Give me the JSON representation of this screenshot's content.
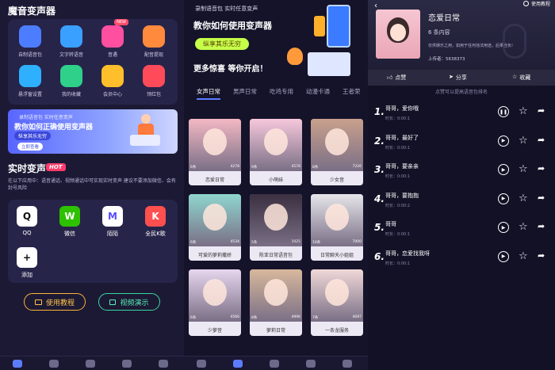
{
  "left": {
    "title": "魔音变声器",
    "tools": [
      {
        "label": "自制语音包",
        "color": "#4c7dff"
      },
      {
        "label": "文字转语音",
        "color": "#3aa0ff"
      },
      {
        "label": "音遇",
        "color": "#ff4fa0",
        "badge": "NEW"
      },
      {
        "label": "配音提现",
        "color": "#ff8a3d"
      },
      {
        "label": "悬浮窗设置",
        "color": "#2fb0ff"
      },
      {
        "label": "我的收藏",
        "color": "#2fd08a"
      },
      {
        "label": "会员中心",
        "color": "#ffbf2a"
      },
      {
        "label": "领红包",
        "color": "#ff4a5a"
      }
    ],
    "banner": {
      "line1": "录制语音包  实时任意变声",
      "line2": "教你如何正确使用变声器",
      "line3": "纵享其乐无穷",
      "button": "立即查看"
    },
    "section": "实时变声",
    "hot": "HOT",
    "desc": "在以下应用中：语音通话、视频通话中可实现实时变声 建议不要添加微信、会有封号风险",
    "apps": [
      {
        "label": "QQ",
        "glyph": "Q",
        "color": "#ffffff",
        "fg": "#111111"
      },
      {
        "label": "微信",
        "glyph": "W",
        "color": "#2dc100",
        "fg": "#ffffff"
      },
      {
        "label": "陌陌",
        "glyph": "M",
        "color": "#ffffff",
        "fg": "#5a4bff"
      },
      {
        "label": "全民K歌",
        "glyph": "K",
        "color": "#ff4f4f",
        "fg": "#ffffff"
      },
      {
        "label": "添加",
        "glyph": "+",
        "color": "#ffffff",
        "fg": "#111111"
      }
    ],
    "btn_tutorial": "使用教程",
    "btn_video": "视频演示"
  },
  "middle": {
    "top_line": "录制语音包   实时任意变声",
    "headline": "教你如何使用变声器",
    "pill": "纵享其乐无穷",
    "slogan": "更多惊喜  等你开启！",
    "tabs": [
      "女声日常",
      "男声日常",
      "吃鸡专用",
      "动漫卡通",
      "王者荣"
    ],
    "cards": [
      {
        "name": "恋爱日常",
        "count": "6条",
        "plays": "4278",
        "tone": "#f3b8c4"
      },
      {
        "name": "小萌妹",
        "count": "9条",
        "plays": "4578",
        "tone": "#f7c8dc"
      },
      {
        "name": "少女音",
        "count": "8条",
        "plays": "7226",
        "tone": "#c9a08c"
      },
      {
        "name": "可爱的萝莉撒娇",
        "count": "6条",
        "plays": "4534",
        "tone": "#8fd6cf"
      },
      {
        "name": "陈亚日常语音包",
        "count": "5条",
        "plays": "1025",
        "tone": "#3a3040"
      },
      {
        "name": "日常聊天小姐姐",
        "count": "10条",
        "plays": "7000",
        "tone": "#e6e6ea"
      },
      {
        "name": "少萝音",
        "count": "6条",
        "plays": "4566",
        "tone": "#e6d6ee"
      },
      {
        "name": "萝莉日常",
        "count": "8条",
        "plays": "4996",
        "tone": "#d8b89c"
      },
      {
        "name": "一条龙服务",
        "count": "7条",
        "plays": "4097",
        "tone": "#f0d8d8"
      }
    ]
  },
  "right": {
    "help": "使用教程",
    "title": "恋爱日常",
    "count": "6 条内容",
    "desc": "仅供娱乐之用，如用于任何违法用途，后果自负!",
    "uploader": "上传者：5638373",
    "actions": [
      "点赞",
      "分享",
      "收藏"
    ],
    "hint": "点赞可以提高语音包排名",
    "items": [
      {
        "num": "1.",
        "title": "哥哥，爱你哦",
        "dur": "时长：0:00:1",
        "state": "pause"
      },
      {
        "num": "2.",
        "title": "哥哥，最好了",
        "dur": "时长：0:00:1",
        "state": "play"
      },
      {
        "num": "3.",
        "title": "哥哥，要亲亲",
        "dur": "时长：0:00:1",
        "state": "play"
      },
      {
        "num": "4.",
        "title": "哥哥，要抱抱",
        "dur": "时长：0:00:2",
        "state": "play"
      },
      {
        "num": "5.",
        "title": "哥哥",
        "dur": "时长：0:00:1",
        "state": "play"
      },
      {
        "num": "6.",
        "title": "哥哥，恋爱找我呀",
        "dur": "时长：0:00:1",
        "state": "play"
      }
    ]
  }
}
